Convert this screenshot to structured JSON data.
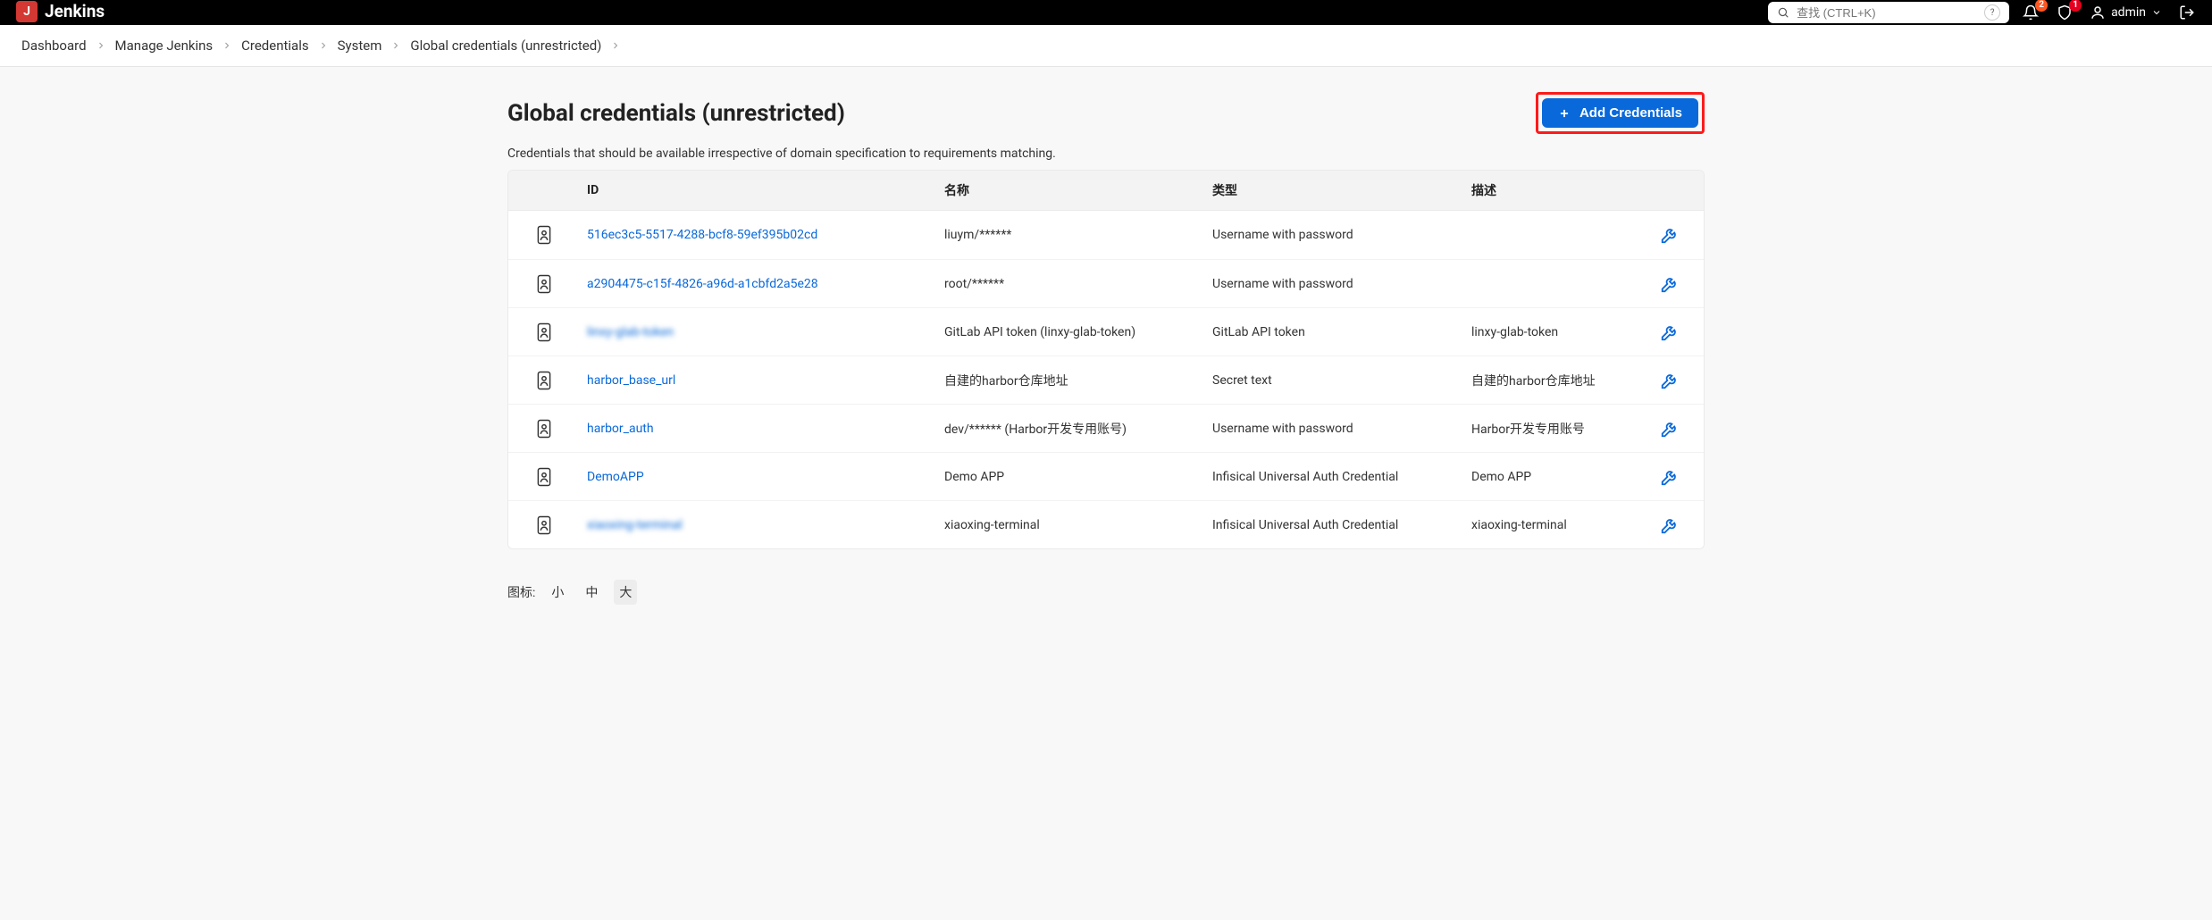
{
  "header": {
    "brand": "Jenkins",
    "search_placeholder": "查找 (CTRL+K)",
    "notif_count": "2",
    "alert_count": "1",
    "user_label": "admin"
  },
  "breadcrumbs": [
    "Dashboard",
    "Manage Jenkins",
    "Credentials",
    "System",
    "Global credentials (unrestricted)"
  ],
  "page": {
    "title": "Global credentials (unrestricted)",
    "description": "Credentials that should be available irrespective of domain specification to requirements matching.",
    "add_button": "Add Credentials"
  },
  "columns": {
    "id": "ID",
    "name": "名称",
    "type": "类型",
    "desc": "描述"
  },
  "rows": [
    {
      "id": "516ec3c5-5517-4288-bcf8-59ef395b02cd",
      "name": "liuym/******",
      "type": "Username with password",
      "desc": "",
      "blurred": false
    },
    {
      "id": "a2904475-c15f-4826-a96d-a1cbfd2a5e28",
      "name": "root/******",
      "type": "Username with password",
      "desc": "",
      "blurred": false
    },
    {
      "id": "linxy-glab-token",
      "name": "GitLab API token (linxy-glab-token)",
      "type": "GitLab API token",
      "desc": "linxy-glab-token",
      "blurred": true
    },
    {
      "id": "harbor_base_url",
      "name": "自建的harbor仓库地址",
      "type": "Secret text",
      "desc": "自建的harbor仓库地址",
      "blurred": false
    },
    {
      "id": "harbor_auth",
      "name": "dev/****** (Harbor开发专用账号)",
      "type": "Username with password",
      "desc": "Harbor开发专用账号",
      "blurred": false
    },
    {
      "id": "DemoAPP",
      "name": "Demo APP",
      "type": "Infisical Universal Auth Credential",
      "desc": "Demo APP",
      "blurred": false
    },
    {
      "id": "xiaoxing-terminal",
      "name": "xiaoxing-terminal",
      "type": "Infisical Universal Auth Credential",
      "desc": "xiaoxing-terminal",
      "blurred": true
    }
  ],
  "footer": {
    "label": "图标:",
    "sizes": [
      "小",
      "中",
      "大"
    ],
    "selected": "大"
  }
}
